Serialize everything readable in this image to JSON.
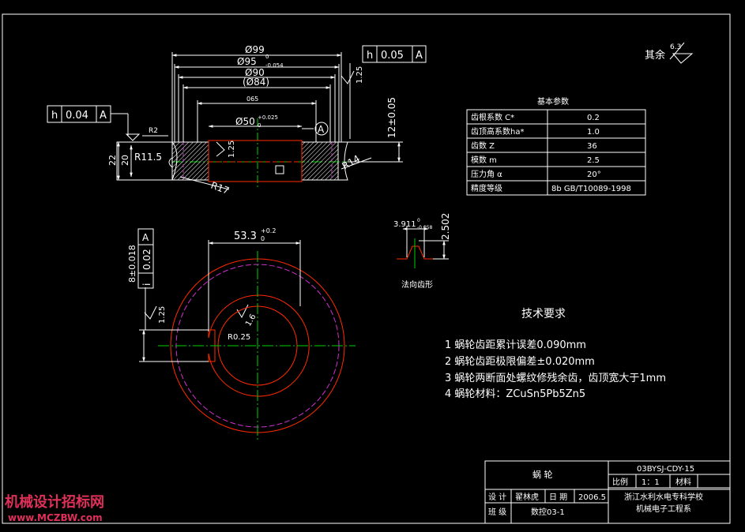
{
  "dims": {
    "d99": "Ø99",
    "d95": "Ø95",
    "d95_tol_upper": "0",
    "d95_tol_lower": "-0.054",
    "d90": "Ø90",
    "d84": "(Ø84)",
    "d65": "065",
    "d50": "Ø50",
    "d50_tol_upper": "+0.025",
    "d50_tol_lower": "0",
    "h12": "12±0.05",
    "h22": "22",
    "h20": "20",
    "r2": "R2",
    "r11_5": "R11.5",
    "r14": "R14",
    "r17": "R17",
    "rough_125a": "1.25",
    "rough_125b": "1.25",
    "rough_125c": "1.25",
    "rough_16": "1.6",
    "datum_a": "A",
    "key_w": "53.3",
    "key_tol_upper": "+0.2",
    "key_tol_lower": "0",
    "key_tol_width": "8±0.018",
    "r0_25": "R0.25"
  },
  "tolerances": {
    "top": {
      "sym": "h",
      "val": "0.05",
      "datum": "A"
    },
    "left": {
      "sym": "h",
      "val": "0.04",
      "datum": "A"
    },
    "side": {
      "sym": "i",
      "val": "0.02",
      "datum": "A"
    }
  },
  "surface_note": {
    "label": "其余",
    "value": "6.3"
  },
  "params": {
    "title": "基本参数",
    "rows": [
      {
        "name": "齿根系数 C*",
        "value": "0.2"
      },
      {
        "name": "齿顶高系数ha*",
        "value": "1.0"
      },
      {
        "name": "齿数 Z",
        "value": "36"
      },
      {
        "name": "模数 m",
        "value": "2.5"
      },
      {
        "name": "压力角 α",
        "value": "20°"
      },
      {
        "name": "精度等级",
        "value": "8b GB/T10089-1998"
      }
    ]
  },
  "tooth": {
    "w": "3.911",
    "w_tol_upper": "0",
    "w_tol_lower": "-0.058",
    "h": "2.502",
    "label": "法向齿形"
  },
  "tech": {
    "title": "技术要求",
    "items": [
      "1  蜗轮齿距累计误差0.090mm",
      "2  蜗轮齿距极限偏差±0.020mm",
      "3  蜗轮两断面处螺纹修残余齿，齿顶宽大于1mm",
      "4  蜗轮材料：ZCuSn5Pb5Zn5"
    ]
  },
  "title_block": {
    "part": "蜗    轮",
    "code": "03BYSJ-CDY-15",
    "scale_label": "比例",
    "scale": "1：1",
    "material_label": "材料",
    "design_label": "设 计",
    "designer": "翟林虎",
    "date_label": "日 期",
    "date": "2006.5",
    "class_label": "班 级",
    "class": "数控03-1",
    "school": "浙江水利水电专科学校",
    "dept": "机械电子工程系"
  },
  "watermark": {
    "line1": "机械设计招标网",
    "line2": "www.MCZBW.com"
  },
  "colors": {
    "bg": "#000000",
    "line": "#ffffff",
    "center": "#00d000",
    "red": "#ff2a00",
    "magenta": "#d030d0",
    "watermark": "#e0305a"
  }
}
